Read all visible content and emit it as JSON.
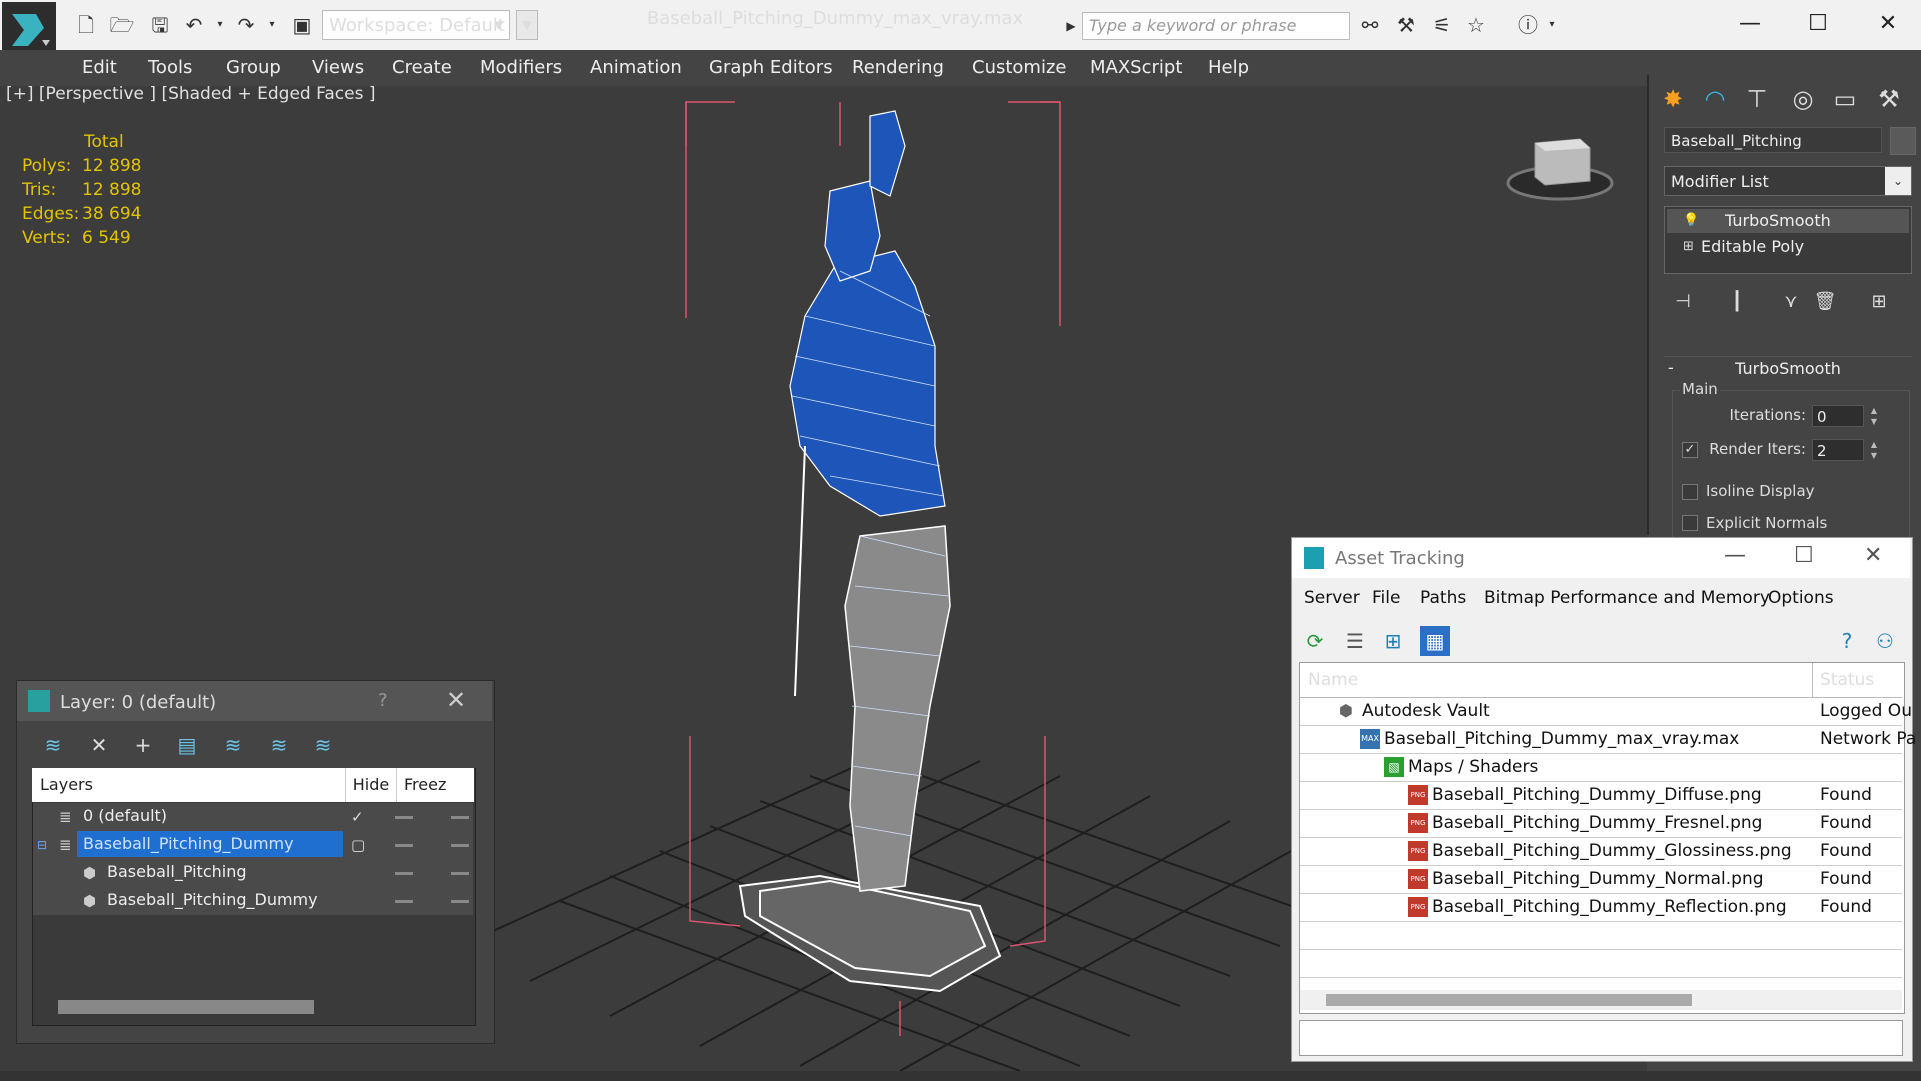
{
  "titlebar": {
    "workspace_label": "Workspace: Default",
    "document_title": "Baseball_Pitching_Dummy_max_vray.max",
    "search_placeholder": "Type a keyword or phrase"
  },
  "menu": [
    "Edit",
    "Tools",
    "Group",
    "Views",
    "Create",
    "Modifiers",
    "Animation",
    "Graph Editors",
    "Rendering",
    "Customize",
    "MAXScript",
    "Help"
  ],
  "viewport": {
    "label": "[+] [Perspective ] [Shaded + Edged Faces ]",
    "stats": {
      "header": "Total",
      "rows": [
        {
          "label": "Polys:",
          "value": "12 898"
        },
        {
          "label": "Tris:",
          "value": "12 898"
        },
        {
          "label": "Edges:",
          "value": "38 694"
        },
        {
          "label": "Verts:",
          "value": "6 549"
        }
      ]
    },
    "accent_color": "#e4c400"
  },
  "command_panel": {
    "object_name": "Baseball_Pitching",
    "modifier_list": "Modifier List",
    "stack": [
      "TurboSmooth",
      "Editable Poly"
    ],
    "rollout_title": "TurboSmooth",
    "group_label": "Main",
    "iterations_label": "Iterations:",
    "iterations_value": "0",
    "render_iters_label": "Render Iters:",
    "render_iters_value": "2",
    "isoline_label": "Isoline Display",
    "explicit_normals_label": "Explicit Normals"
  },
  "layer_dialog": {
    "title": "Layer: 0 (default)",
    "help": "?",
    "columns": [
      "Layers",
      "Hide",
      "Freez"
    ],
    "rows": [
      {
        "name": "0 (default)",
        "indent": 0,
        "selected": false
      },
      {
        "name": "Baseball_Pitching_Dummy",
        "indent": 0,
        "selected": true
      },
      {
        "name": "Baseball_Pitching",
        "indent": 1,
        "selected": false
      },
      {
        "name": "Baseball_Pitching_Dummy",
        "indent": 1,
        "selected": false
      }
    ]
  },
  "asset_tracking": {
    "title": "Asset Tracking",
    "menu": [
      "Server",
      "File",
      "Paths",
      "Bitmap Performance and Memory",
      "Options"
    ],
    "columns": [
      "Name",
      "Status"
    ],
    "rows": [
      {
        "name": "Autodesk Vault",
        "status": "Logged Ou",
        "indent": 0,
        "icon": "vault-icon"
      },
      {
        "name": "Baseball_Pitching_Dummy_max_vray.max",
        "status": "Network Pa",
        "indent": 1,
        "icon": "max-file-icon"
      },
      {
        "name": "Maps / Shaders",
        "status": "",
        "indent": 2,
        "icon": "maps-folder-icon"
      },
      {
        "name": "Baseball_Pitching_Dummy_Diffuse.png",
        "status": "Found",
        "indent": 3,
        "icon": "png-icon"
      },
      {
        "name": "Baseball_Pitching_Dummy_Fresnel.png",
        "status": "Found",
        "indent": 3,
        "icon": "png-icon"
      },
      {
        "name": "Baseball_Pitching_Dummy_Glossiness.png",
        "status": "Found",
        "indent": 3,
        "icon": "png-icon"
      },
      {
        "name": "Baseball_Pitching_Dummy_Normal.png",
        "status": "Found",
        "indent": 3,
        "icon": "png-icon"
      },
      {
        "name": "Baseball_Pitching_Dummy_Reflection.png",
        "status": "Found",
        "indent": 3,
        "icon": "png-icon"
      }
    ],
    "selection_color": "#2b6fc7"
  }
}
